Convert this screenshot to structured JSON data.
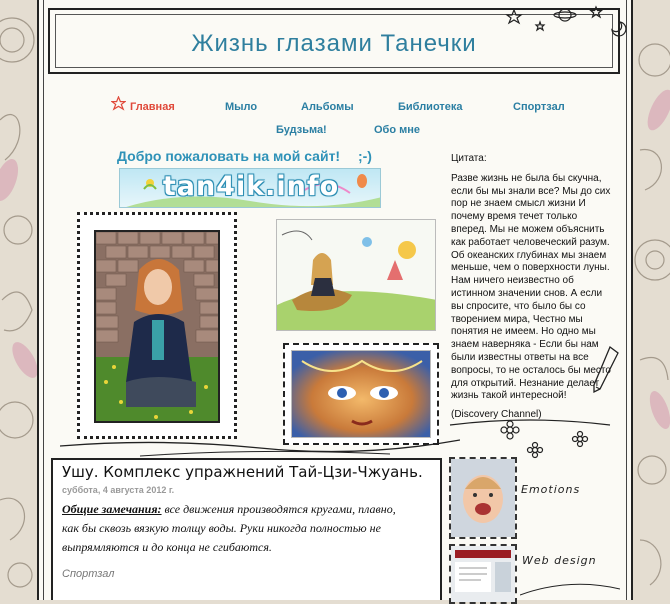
{
  "site": {
    "title": "Жизнь глазами Танечки"
  },
  "nav": {
    "items": [
      {
        "label": "Главная",
        "active": true
      },
      {
        "label": "Мыло"
      },
      {
        "label": "Альбомы"
      },
      {
        "label": "Библиотека"
      },
      {
        "label": "Спортзал"
      },
      {
        "label": "Будзьма!"
      },
      {
        "label": "Обо мне"
      }
    ]
  },
  "welcome": {
    "text": "Добро пожаловать на мой сайт!",
    "smiley": ";-)"
  },
  "logo": {
    "text": "tan4ik.info"
  },
  "quote": {
    "title": "Цитата:",
    "body": "Разве жизнь не была бы скучна, если бы мы знали все? Мы до сих пор не знаем смысл жизни И почему время течет только вперед. Мы не можем объяснить как работает человеческий разум. Об океанских глубинах мы знаем меньше, чем о поверхности луны. Нам ничего неизвестно об истинном значении снов. А если вы спросите, что было бы со творением мира, Честно мы понятия не имеем. Но одно мы знаем наверняка - Если бы нам были известны ответы на все вопросы, то не осталось бы место для открытий. Незнание делает жизнь такой интересной!",
    "source": "(Discovery Channel)"
  },
  "post": {
    "title": "Ушу. Комплекс упражнений Тай-Цзи-Чжуань.",
    "date": "суббота, 4 августа 2012 г.",
    "lead": "Общие замечания:",
    "body": " все движения производятся кругами, плавно, как бы сквозь вязкую толщу воды. Руки никогда полностью не выпрямляются и до конца не сгибаются.",
    "label": "Спортзал"
  },
  "sidebar": {
    "emotions_label": "Emotions",
    "webdesign_label": "Web design"
  },
  "colors": {
    "title": "#2f7f9e",
    "nav": "#2b7fa3",
    "nav_active": "#e0493a",
    "welcome": "#2f92b8"
  }
}
